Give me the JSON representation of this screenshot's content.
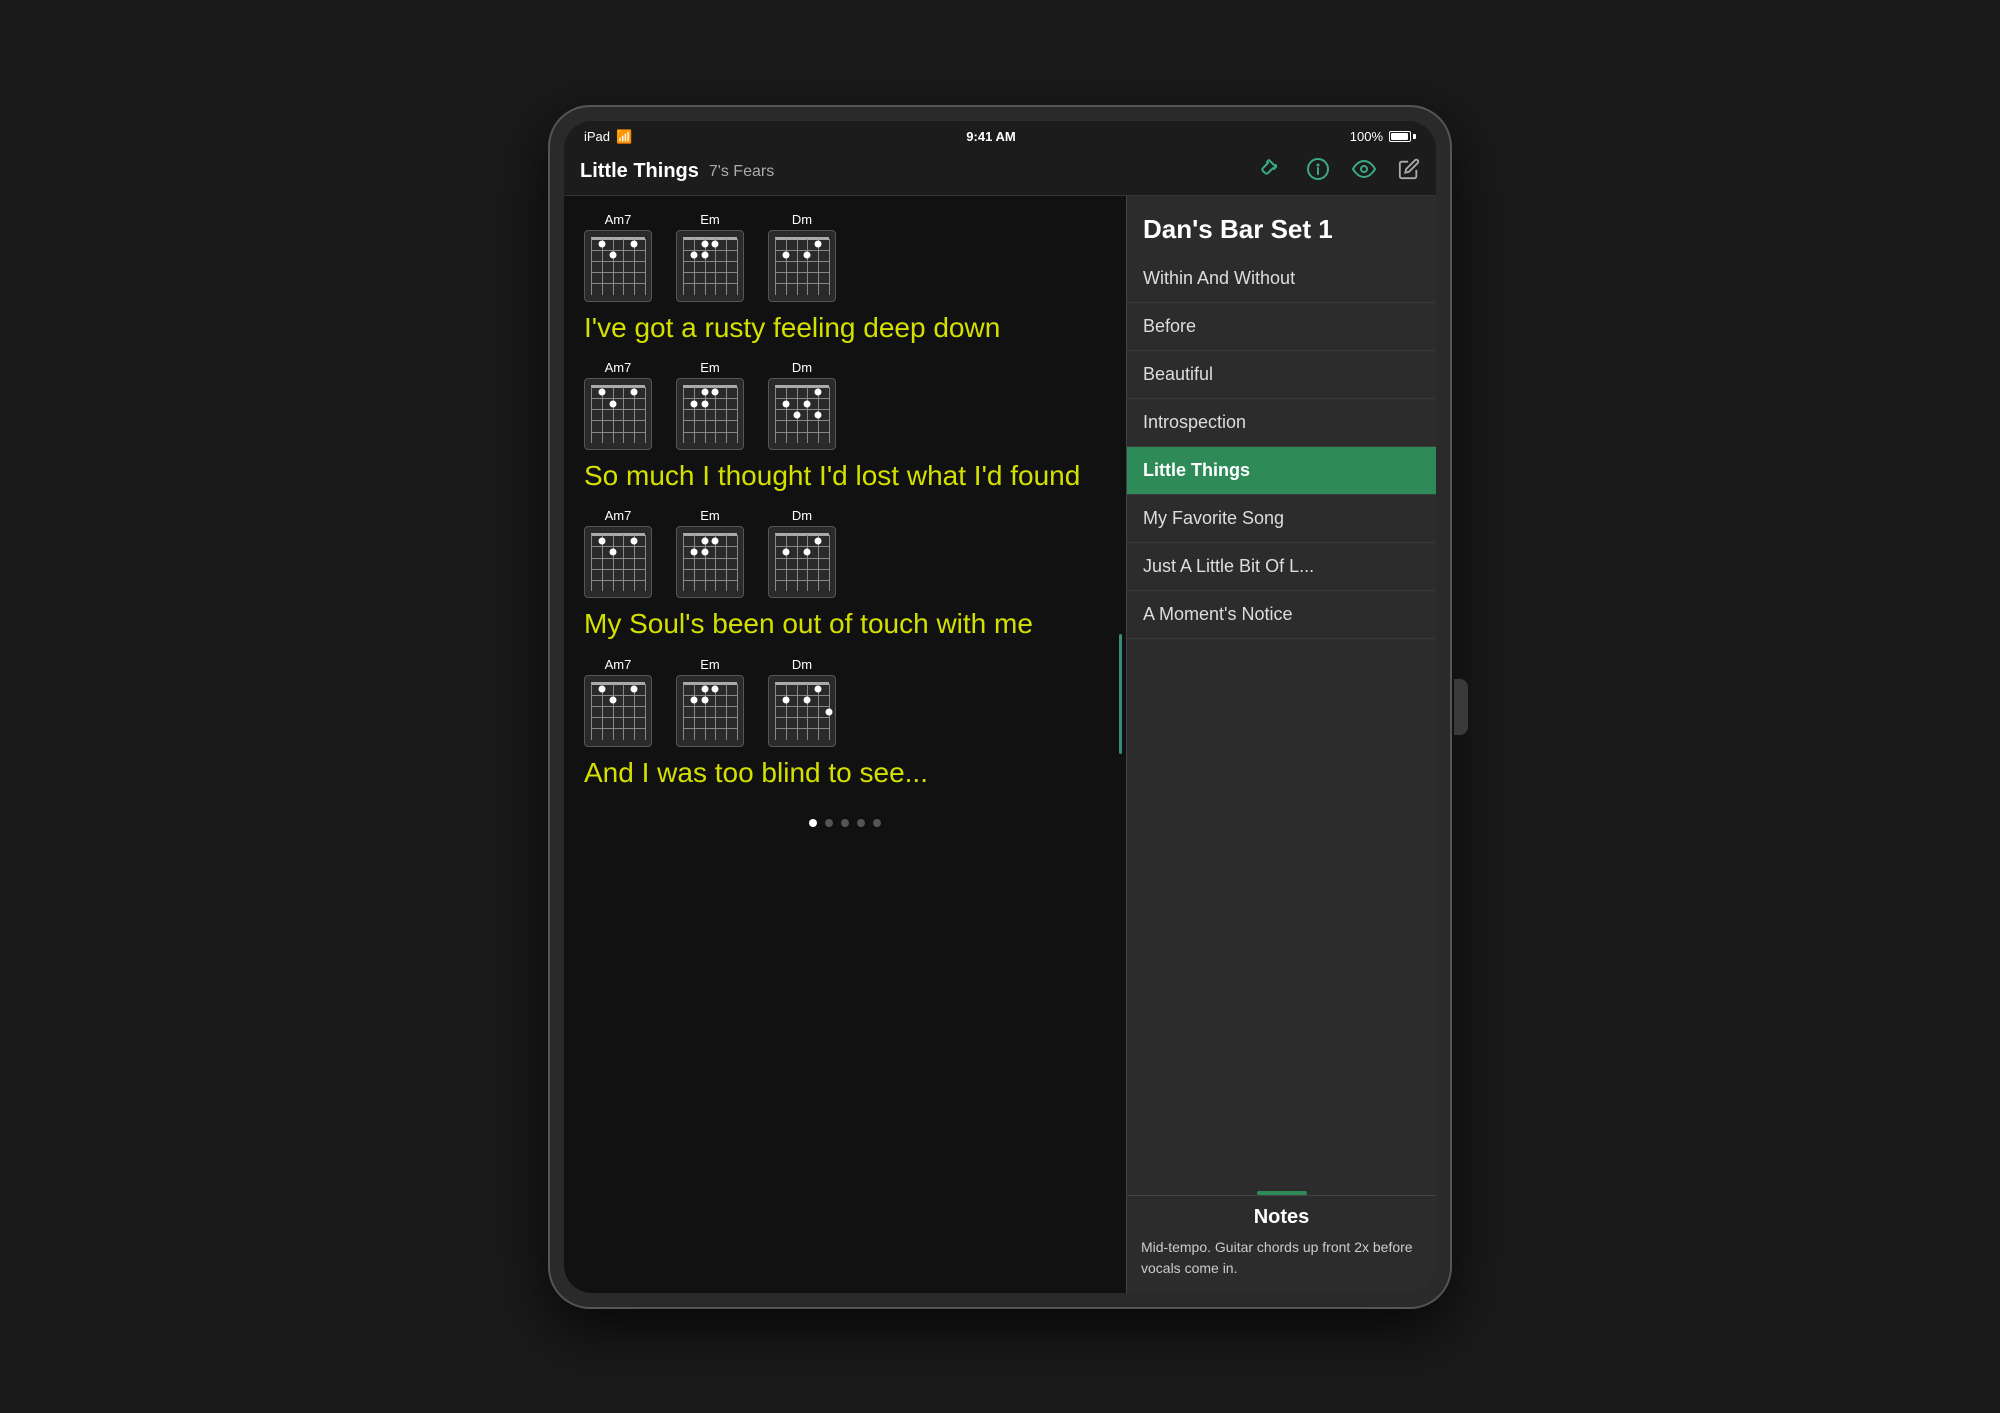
{
  "device": {
    "status_bar": {
      "left": "iPad",
      "wifi": "wifi",
      "time": "9:41 AM",
      "battery_percent": "100%"
    }
  },
  "toolbar": {
    "song_title": "Little Things",
    "song_subtitle": "7's Fears",
    "icons": {
      "guitar": "guitar-icon",
      "info": "info-icon",
      "eye": "eye-icon",
      "pencil": "pencil-icon"
    }
  },
  "song": {
    "chords": [
      "Am7",
      "Em",
      "Dm"
    ],
    "verses": [
      {
        "id": 1,
        "lyric": "I've got a rusty feeling deep down"
      },
      {
        "id": 2,
        "lyric": "So much I thought I'd lost what I'd found"
      },
      {
        "id": 3,
        "lyric": "My Soul's been out of touch with me"
      },
      {
        "id": 4,
        "lyric": "And I was too blind to see..."
      }
    ],
    "page_dots": [
      {
        "active": true
      },
      {
        "active": false
      },
      {
        "active": false
      },
      {
        "active": false
      },
      {
        "active": false
      }
    ]
  },
  "sidebar": {
    "header": "Dan's Bar Set 1",
    "items": [
      {
        "label": "Within And Without",
        "active": false
      },
      {
        "label": "Before",
        "active": false
      },
      {
        "label": "Beautiful",
        "active": false
      },
      {
        "label": "Introspection",
        "active": false
      },
      {
        "label": "Little Things",
        "active": true
      },
      {
        "label": "My Favorite Song",
        "active": false
      },
      {
        "label": "Just A Little Bit Of L...",
        "active": false
      },
      {
        "label": "A Moment's Notice",
        "active": false
      }
    ]
  },
  "notes": {
    "title": "Notes",
    "text": "Mid-tempo. Guitar chords up front 2x before vocals come in."
  }
}
